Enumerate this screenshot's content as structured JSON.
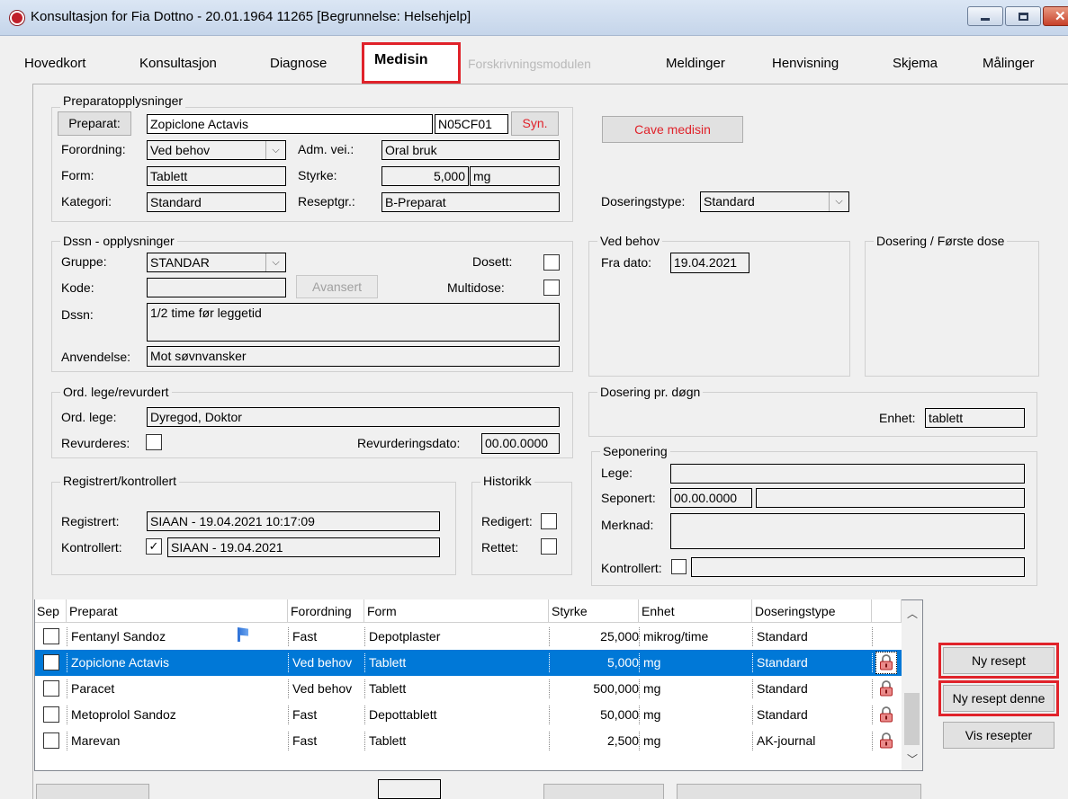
{
  "window": {
    "title": "Konsultasjon for Fia Dottno  -  20.01.1964  11265  [Begrunnelse: Helsehjelp]",
    "controls": {
      "minimize": "minimize-icon",
      "maximize": "maximize-icon",
      "close": "close-icon"
    }
  },
  "tabs": [
    {
      "label": "Hovedkort"
    },
    {
      "label": "Konsultasjon"
    },
    {
      "label": "Diagnose"
    },
    {
      "label": "Medisin",
      "active": true
    },
    {
      "label": "Forskrivningsmodulen",
      "disabled": true
    },
    {
      "label": "Meldinger"
    },
    {
      "label": "Henvisning"
    },
    {
      "label": "Skjema"
    },
    {
      "label": "Målinger"
    }
  ],
  "preparat": {
    "group_title": "Preparatopplysninger",
    "preparat_button": "Preparat:",
    "preparat_value": "Zopiclone Actavis",
    "atc_code": "N05CF01",
    "syn_button": "Syn.",
    "forordning_label": "Forordning:",
    "forordning_value": "Ved behov",
    "adm_label": "Adm. vei.:",
    "adm_value": "Oral bruk",
    "form_label": "Form:",
    "form_value": "Tablett",
    "styrke_label": "Styrke:",
    "styrke_value": "5,000",
    "styrke_unit": "mg",
    "kategori_label": "Kategori:",
    "kategori_value": "Standard",
    "reseptgr_label": "Reseptgr.:",
    "reseptgr_value": "B-Preparat"
  },
  "cave_button": "Cave medisin",
  "doseringstype": {
    "label": "Doseringstype:",
    "value": "Standard"
  },
  "dssn": {
    "group_title": "Dssn - opplysninger",
    "gruppe_label": "Gruppe:",
    "gruppe_value": "STANDAR",
    "dosett_label": "Dosett:",
    "kode_label": "Kode:",
    "kode_value": "",
    "avansert_button": "Avansert",
    "multidose_label": "Multidose:",
    "dssn_label": "Dssn:",
    "dssn_value": "1/2 time før leggetid",
    "anvendelse_label": "Anvendelse:",
    "anvendelse_value": "Mot søvnvansker"
  },
  "ved_behov": {
    "group_title": "Ved behov",
    "fra_dato_label": "Fra dato:",
    "fra_dato_value": "19.04.2021"
  },
  "dosering_forste": {
    "group_title": "Dosering / Første dose"
  },
  "ord_lege": {
    "group_title": "Ord. lege/revurdert",
    "ord_lege_label": "Ord. lege:",
    "ord_lege_value": "Dyregod, Doktor",
    "revurderes_label": "Revurderes:",
    "revurderingsdato_label": "Revurderingsdato:",
    "revurderingsdato_value": "00.00.0000"
  },
  "dosering_dogn": {
    "group_title": "Dosering pr. døgn",
    "enhet_label": "Enhet:",
    "enhet_value": "tablett"
  },
  "seponering": {
    "group_title": "Seponering",
    "lege_label": "Lege:",
    "lege_value": "",
    "seponert_label": "Seponert:",
    "seponert_value": "00.00.0000",
    "merknad_label": "Merknad:",
    "kontrollert_label": "Kontrollert:"
  },
  "registrert": {
    "group_title": "Registrert/kontrollert",
    "registrert_label": "Registrert:",
    "registrert_value": "SIAAN - 19.04.2021 10:17:09",
    "kontrollert_label": "Kontrollert:",
    "kontrollert_value": "SIAAN - 19.04.2021"
  },
  "historikk": {
    "group_title": "Historikk",
    "redigert_label": "Redigert:",
    "rettet_label": "Rettet:"
  },
  "grid": {
    "headers": [
      "Sep",
      "Preparat",
      "Forordning",
      "Form",
      "Styrke",
      "Enhet",
      "Doseringstype"
    ],
    "rows": [
      {
        "preparat": "Fentanyl Sandoz",
        "forordning": "Fast",
        "form": "Depotplaster",
        "styrke": "25,000",
        "enhet": "mikrog/time",
        "doseringstype": "Standard",
        "flag": true,
        "lock": false,
        "selected": false
      },
      {
        "preparat": "Zopiclone Actavis",
        "forordning": "Ved behov",
        "form": "Tablett",
        "styrke": "5,000",
        "enhet": "mg",
        "doseringstype": "Standard",
        "flag": false,
        "lock": true,
        "selected": true
      },
      {
        "preparat": "Paracet",
        "forordning": "Ved behov",
        "form": "Tablett",
        "styrke": "500,000",
        "enhet": "mg",
        "doseringstype": "Standard",
        "flag": false,
        "lock": true,
        "selected": false
      },
      {
        "preparat": "Metoprolol Sandoz",
        "forordning": "Fast",
        "form": "Depottablett",
        "styrke": "50,000",
        "enhet": "mg",
        "doseringstype": "Standard",
        "flag": false,
        "lock": true,
        "selected": false
      },
      {
        "preparat": "Marevan",
        "forordning": "Fast",
        "form": "Tablett",
        "styrke": "2,500",
        "enhet": "mg",
        "doseringstype": "AK-journal",
        "flag": false,
        "lock": true,
        "selected": false
      }
    ]
  },
  "side_buttons": {
    "ny_resept": "Ny resept",
    "ny_resept_denne": "Ny resept denne",
    "vis_resepter": "Vis resepter"
  },
  "colors": {
    "highlight": "#e0222a",
    "selection": "#0078d7",
    "cave_text": "#e0222a"
  }
}
